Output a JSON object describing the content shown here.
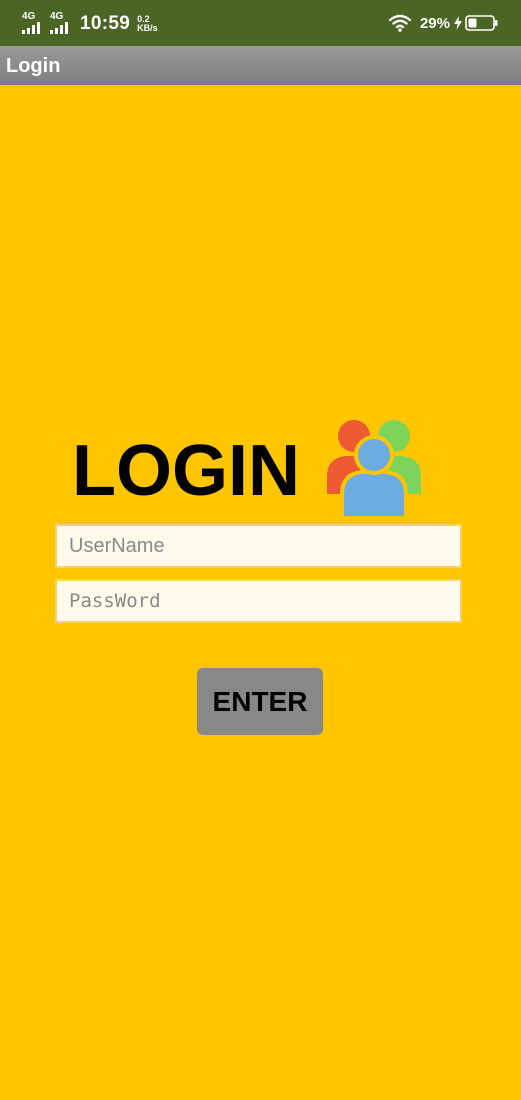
{
  "status_bar": {
    "sim1_label": "4G",
    "sim2_label": "4G",
    "time": "10:59",
    "speed_value": "0.2",
    "speed_unit": "KB/s",
    "battery_percent": "29%",
    "icons": [
      "signal-icon",
      "signal-icon",
      "wifi-icon",
      "charging-bolt-icon",
      "battery-icon"
    ],
    "background_color": "#4B6524"
  },
  "action_bar": {
    "title": "Login"
  },
  "login": {
    "heading": "LOGIN",
    "icon": "users-group-icon",
    "username_placeholder": "UserName",
    "username_value": "",
    "password_placeholder": "PassWord",
    "password_value": "",
    "enter_label": "ENTER"
  },
  "colors": {
    "background": "#FFC600",
    "field_background": "#FFFAEC",
    "field_border": "#F4D469",
    "button": "#888887",
    "person_left": "#EE5A33",
    "person_right": "#7ED45B",
    "person_center": "#6BADE0"
  }
}
